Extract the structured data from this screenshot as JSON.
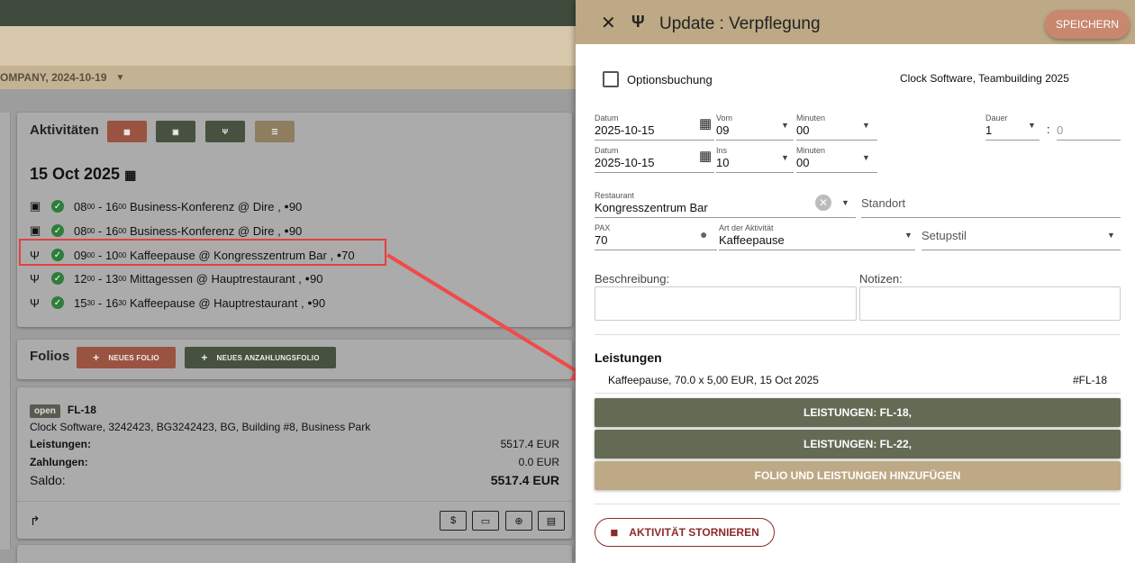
{
  "crumb": {
    "text": "OMPANY, 2024-10-19"
  },
  "activities": {
    "title": "Aktivitäten",
    "date": "15 Oct 2025",
    "rows": [
      {
        "s1": "08",
        "e1": "00",
        "s2": "16",
        "e2": "00",
        "desc": "Business-Konferenz @ Dire ,",
        "pax": "90"
      },
      {
        "s1": "08",
        "e1": "00",
        "s2": "16",
        "e2": "00",
        "desc": "Business-Konferenz @ Dire ,",
        "pax": "90"
      },
      {
        "s1": "09",
        "e1": "00",
        "s2": "10",
        "e2": "00",
        "desc": "Kaffeepause @ Kongresszentrum Bar ,",
        "pax": "70"
      },
      {
        "s1": "12",
        "e1": "00",
        "s2": "13",
        "e2": "00",
        "desc": "Mittagessen @ Hauptrestaurant ,",
        "pax": "90"
      },
      {
        "s1": "15",
        "e1": "30",
        "s2": "16",
        "e2": "30",
        "desc": "Kaffeepause @ Hauptrestaurant ,",
        "pax": "90"
      }
    ]
  },
  "folios": {
    "title": "Folios",
    "new_folio": "NEUES FOLIO",
    "new_deposit": "NEUES ANZAHLUNGSFOLIO",
    "status": "open",
    "id": "FL-18",
    "address": "Clock Software, 3242423, BG3242423, BG, Building #8, Business Park",
    "leistungen_label": "Leistungen:",
    "leistungen_val": "5517.4 EUR",
    "zahlungen_label": "Zahlungen:",
    "zahlungen_val": "0.0 EUR",
    "saldo_label": "Saldo:",
    "saldo_val": "5517.4 EUR"
  },
  "panel": {
    "title": "Update : Verpflegung",
    "save": "SPEICHERN",
    "option_label": "Optionsbuchung",
    "client": "Clock Software, Teambuilding 2025",
    "datum_label": "Datum",
    "date1": "2025-10-15",
    "vom_label": "Vom",
    "vom": "09",
    "min_label": "Minuten",
    "min1": "00",
    "dauer_label": "Dauer",
    "dauer": "1",
    "dauer_min": "0",
    "date2": "2025-10-15",
    "ins_label": "Ins",
    "ins": "10",
    "min2": "00",
    "restaurant_label": "Restaurant",
    "restaurant": "Kongresszentrum Bar",
    "standort": "Standort",
    "pax_label": "PAX",
    "pax": "70",
    "art_label": "Art der Aktivität",
    "art": "Kaffeepause",
    "setup": "Setupstil",
    "beschreibung": "Beschreibung:",
    "notizen": "Notizen:",
    "leistungen_title": "Leistungen",
    "leistung_item": "Kaffeepause, 70.0 x 5,00 EUR, 15 Oct 2025",
    "leistung_ref": "#FL-18",
    "btn1": "LEISTUNGEN: FL-18,",
    "btn2": "LEISTUNGEN: FL-22,",
    "btn3": "FOLIO UND LEISTUNGEN HINZUFÜGEN",
    "cancel": "AKTIVITÄT STORNIEREN"
  }
}
